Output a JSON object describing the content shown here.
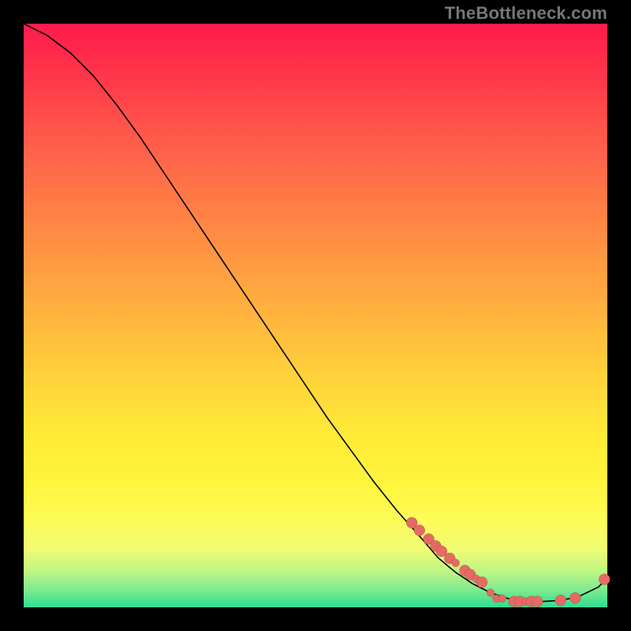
{
  "watermark": "TheBottleneck.com",
  "colors": {
    "dot": "#e66a64",
    "curve": "#000000",
    "gradient_top": "#ff1a4d",
    "gradient_bottom": "#2fdd94",
    "background": "#000000"
  },
  "chart_data": {
    "type": "line",
    "title": "",
    "xlabel": "",
    "ylabel": "",
    "xlim": [
      0,
      100
    ],
    "ylim": [
      0,
      100
    ],
    "grid": false,
    "legend": false,
    "series": [
      {
        "name": "curve",
        "x": [
          0,
          4,
          8,
          12,
          16,
          20,
          24,
          28,
          32,
          36,
          40,
          44,
          48,
          52,
          56,
          60,
          64,
          68,
          71,
          74,
          77,
          80,
          83,
          86,
          89,
          92,
          95,
          98.5,
          100
        ],
        "y": [
          100,
          98,
          95,
          91,
          86,
          80.5,
          74.5,
          68.5,
          62.5,
          56.5,
          50.5,
          44.5,
          38.5,
          32.5,
          27,
          21.5,
          16.5,
          12,
          8.5,
          6,
          4,
          2.5,
          1.5,
          1,
          1,
          1.2,
          1.8,
          3.5,
          5
        ]
      }
    ],
    "markers": [
      {
        "x": 66.5,
        "y": 14.5,
        "size": "big"
      },
      {
        "x": 67.8,
        "y": 13.2,
        "size": "big"
      },
      {
        "x": 69.4,
        "y": 11.7,
        "size": "big"
      },
      {
        "x": 70.6,
        "y": 10.5,
        "size": "big"
      },
      {
        "x": 71.6,
        "y": 9.6,
        "size": "big"
      },
      {
        "x": 73.0,
        "y": 8.4,
        "size": "big"
      },
      {
        "x": 74.0,
        "y": 7.6,
        "size": "small"
      },
      {
        "x": 75.6,
        "y": 6.3,
        "size": "big"
      },
      {
        "x": 76.5,
        "y": 5.6,
        "size": "big"
      },
      {
        "x": 77.5,
        "y": 4.9,
        "size": "small"
      },
      {
        "x": 78.5,
        "y": 4.3,
        "size": "big"
      },
      {
        "x": 80.0,
        "y": 2.5,
        "size": "small"
      },
      {
        "x": 81.0,
        "y": 1.5,
        "size": "small"
      },
      {
        "x": 82.0,
        "y": 1.5,
        "size": "small"
      },
      {
        "x": 84.0,
        "y": 1.0,
        "size": "big"
      },
      {
        "x": 85.0,
        "y": 1.0,
        "size": "big"
      },
      {
        "x": 86.0,
        "y": 1.0,
        "size": "small"
      },
      {
        "x": 87.0,
        "y": 1.0,
        "size": "big"
      },
      {
        "x": 88.0,
        "y": 1.0,
        "size": "big"
      },
      {
        "x": 92.0,
        "y": 1.2,
        "size": "big"
      },
      {
        "x": 94.5,
        "y": 1.6,
        "size": "big"
      },
      {
        "x": 99.5,
        "y": 4.8,
        "size": "big"
      }
    ]
  }
}
